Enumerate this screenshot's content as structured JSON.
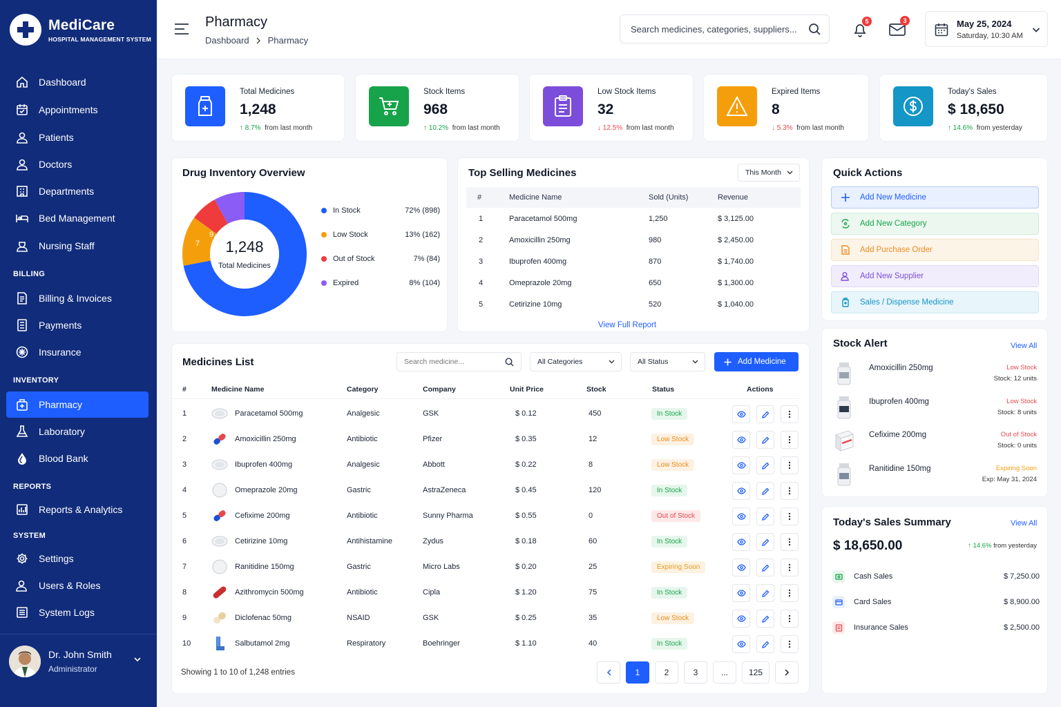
{
  "brand": {
    "name": "MediCare",
    "subtitle": "HOSPITAL MANAGEMENT SYSTEM"
  },
  "sidebar": {
    "items": [
      {
        "label": "Dashboard",
        "icon": "home-icon"
      },
      {
        "label": "Appointments",
        "icon": "calendar-check-icon"
      },
      {
        "label": "Patients",
        "icon": "user-icon"
      },
      {
        "label": "Doctors",
        "icon": "doctor-icon"
      },
      {
        "label": "Departments",
        "icon": "building-icon"
      },
      {
        "label": "Bed Management",
        "icon": "bed-icon"
      },
      {
        "label": "Nursing Staff",
        "icon": "nurse-icon"
      }
    ],
    "billing_title": "BILLING",
    "billing": [
      {
        "label": "Billing & Invoices"
      },
      {
        "label": "Payments"
      },
      {
        "label": "Insurance"
      }
    ],
    "inventory_title": "INVENTORY",
    "inventory": [
      {
        "label": "Pharmacy"
      },
      {
        "label": "Laboratory"
      },
      {
        "label": "Blood Bank"
      }
    ],
    "reports_title": "REPORTS",
    "reports": [
      {
        "label": "Reports & Analytics"
      }
    ],
    "system_title": "SYSTEM",
    "system": [
      {
        "label": "Settings"
      },
      {
        "label": "Users & Roles"
      },
      {
        "label": "System Logs"
      }
    ],
    "profile": {
      "name": "Dr. John Smith",
      "role": "Administrator"
    }
  },
  "header": {
    "title": "Pharmacy",
    "breadcrumb": [
      "Dashboard",
      "Pharmacy"
    ],
    "search_placeholder": "Search medicines, categories, suppliers...",
    "notifications": "5",
    "messages": "3",
    "date": "May 25, 2024",
    "datetime": "Saturday, 10:30 AM"
  },
  "stats": [
    {
      "label": "Total Medicines",
      "value": "1,248",
      "trend": "8.7%",
      "trend_text": "from last month",
      "dir": "up",
      "color": "#1e5eff"
    },
    {
      "label": "Stock Items",
      "value": "968",
      "trend": "10.2%",
      "trend_text": "from last month",
      "dir": "up",
      "color": "#16a34a"
    },
    {
      "label": "Low Stock Items",
      "value": "32",
      "trend": "12.5%",
      "trend_text": "from last month",
      "dir": "down",
      "color": "#7c4ddb"
    },
    {
      "label": "Expired Items",
      "value": "8",
      "trend": "5.3%",
      "trend_text": "from last month",
      "dir": "down",
      "color": "#f59e0b"
    },
    {
      "label": "Today's Sales",
      "value": "$ 18,650",
      "trend": "14.6%",
      "trend_text": "from yesterday",
      "dir": "up",
      "color": "#1496c6"
    }
  ],
  "inventory_overview": {
    "title": "Drug Inventory Overview",
    "center_value": "1,248",
    "center_label": "Total Medicines",
    "legend": [
      {
        "label": "In Stock",
        "value": "72% (898)",
        "color": "#1e5eff"
      },
      {
        "label": "Low Stock",
        "value": "13% (162)",
        "color": "#f59e0b"
      },
      {
        "label": "Out of Stock",
        "value": "7% (84)",
        "color": "#ef3b3b"
      },
      {
        "label": "Expired",
        "value": "8% (104)",
        "color": "#8b5cf6"
      }
    ],
    "segment_labels": [
      "7",
      "9",
      "8"
    ]
  },
  "top_selling": {
    "title": "Top Selling Medicines",
    "period": "This Month",
    "columns": [
      "#",
      "Medicine Name",
      "Sold (Units)",
      "Revenue"
    ],
    "rows": [
      [
        "1",
        "Paracetamol 500mg",
        "1,250",
        "$ 3,125.00"
      ],
      [
        "2",
        "Amoxicillin 250mg",
        "980",
        "$ 2,450.00"
      ],
      [
        "3",
        "Ibuprofen 400mg",
        "870",
        "$ 1,740.00"
      ],
      [
        "4",
        "Omeprazole 20mg",
        "650",
        "$ 1,300.00"
      ],
      [
        "5",
        "Cetirizine 10mg",
        "520",
        "$ 1,040.00"
      ]
    ],
    "link": "View Full Report"
  },
  "quick_actions": {
    "title": "Quick Actions",
    "items": [
      {
        "label": "Add New Medicine",
        "color": "#1e5eff",
        "bg": "#e9f0ff",
        "border": "#b7c9f5"
      },
      {
        "label": "Add New Category",
        "color": "#16a34a",
        "bg": "#ecf8ef",
        "border": "#cfe9d6"
      },
      {
        "label": "Add Purchase Order",
        "color": "#ea8c1f",
        "bg": "#fdf4e8",
        "border": "#f6e2c6"
      },
      {
        "label": "Add New Supplier",
        "color": "#7c4ddb",
        "bg": "#f2edfc",
        "border": "#e0d6f6"
      },
      {
        "label": "Sales / Dispense Medicine",
        "color": "#1496c6",
        "bg": "#e8f5fb",
        "border": "#cbe6f2"
      }
    ]
  },
  "stock_alert": {
    "title": "Stock Alert",
    "view_all": "View All",
    "items": [
      {
        "name": "Amoxicillin 250mg",
        "status": "Low Stock",
        "detail": "Stock: 12 units",
        "color": "#e5484d"
      },
      {
        "name": "Ibuprofen 400mg",
        "status": "Low Stock",
        "detail": "Stock: 8 units",
        "color": "#e5484d"
      },
      {
        "name": "Cefixime 200mg",
        "status": "Out of Stock",
        "detail": "Stock: 0 units",
        "color": "#e5484d"
      },
      {
        "name": "Ranitidine 150mg",
        "status": "Expiring Soon",
        "detail": "Exp: May 31, 2024",
        "color": "#f59e0b"
      }
    ]
  },
  "medicines_list": {
    "title": "Medicines List",
    "search_placeholder": "Search medicine...",
    "category_filter": "All Categories",
    "status_filter": "All Status",
    "add_button": "Add Medicine",
    "columns": [
      "#",
      "Medicine Name",
      "Category",
      "Company",
      "Unit Price",
      "Stock",
      "Status",
      "Actions"
    ],
    "rows": [
      {
        "n": "1",
        "name": "Paracetamol 500mg",
        "category": "Analgesic",
        "company": "GSK",
        "price": "$ 0.12",
        "stock": "450",
        "status": "In Stock",
        "pill": "white-tablet-icon"
      },
      {
        "n": "2",
        "name": "Amoxicillin 250mg",
        "category": "Antibiotic",
        "company": "Pfizer",
        "price": "$ 0.35",
        "stock": "12",
        "status": "Low Stock",
        "pill": "capsule-icon"
      },
      {
        "n": "3",
        "name": "Ibuprofen 400mg",
        "category": "Analgesic",
        "company": "Abbott",
        "price": "$ 0.22",
        "stock": "8",
        "status": "Low Stock",
        "pill": "white-tablet-icon"
      },
      {
        "n": "4",
        "name": "Omeprazole 20mg",
        "category": "Gastric",
        "company": "AstraZeneca",
        "price": "$ 0.45",
        "stock": "120",
        "status": "In Stock",
        "pill": "round-tablet-icon"
      },
      {
        "n": "5",
        "name": "Cefixime 200mg",
        "category": "Antibiotic",
        "company": "Sunny Pharma",
        "price": "$ 0.55",
        "stock": "0",
        "status": "Out of Stock",
        "pill": "capsule-icon"
      },
      {
        "n": "6",
        "name": "Cetirizine 10mg",
        "category": "Antihistamine",
        "company": "Zydus",
        "price": "$ 0.18",
        "stock": "60",
        "status": "In Stock",
        "pill": "white-tablet-icon"
      },
      {
        "n": "7",
        "name": "Ranitidine 150mg",
        "category": "Gastric",
        "company": "Micro Labs",
        "price": "$ 0.20",
        "stock": "25",
        "status": "Expiring Soon",
        "pill": "round-tablet-icon"
      },
      {
        "n": "8",
        "name": "Azithromycin 500mg",
        "category": "Antibiotic",
        "company": "Cipla",
        "price": "$ 1.20",
        "stock": "75",
        "status": "In Stock",
        "pill": "red-capsule-icon"
      },
      {
        "n": "9",
        "name": "Diclofenac 50mg",
        "category": "NSAID",
        "company": "GSK",
        "price": "$ 0.25",
        "stock": "35",
        "status": "Low Stock",
        "pill": "beige-capsule-icon"
      },
      {
        "n": "10",
        "name": "Salbutamol 2mg",
        "category": "Respiratory",
        "company": "Boehringer",
        "price": "$ 1.10",
        "stock": "40",
        "status": "In Stock",
        "pill": "inhaler-icon"
      }
    ],
    "showing": "Showing 1 to 10 of 1,248 entries",
    "pages": [
      "1",
      "2",
      "3",
      "...",
      "125"
    ]
  },
  "sales_summary": {
    "title": "Today's Sales Summary",
    "view_all": "View All",
    "total": "$ 18,650.00",
    "trend": "14.6%",
    "trend_text": "from yesterday",
    "items": [
      {
        "label": "Cash Sales",
        "value": "$ 7,250.00",
        "color": "#16a34a",
        "bg": "#e6f6ec"
      },
      {
        "label": "Card Sales",
        "value": "$ 8,900.00",
        "color": "#1e5eff",
        "bg": "#e9f0ff"
      },
      {
        "label": "Insurance Sales",
        "value": "$ 2,500.00",
        "color": "#e5484d",
        "bg": "#fde8e8"
      }
    ]
  }
}
